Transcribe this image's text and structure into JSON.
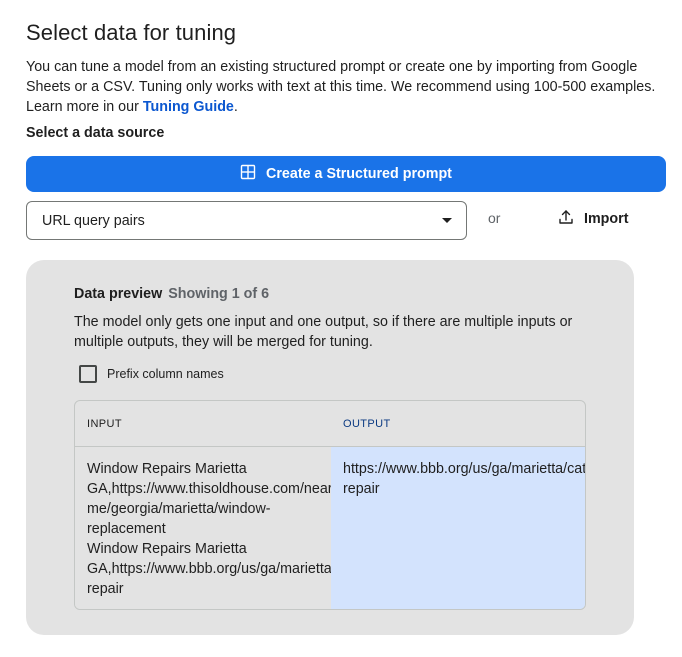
{
  "header": {
    "title": "Select data for tuning",
    "description_pre": "You can tune a model from an existing structured prompt or create one by importing from Google Sheets or a CSV. Tuning only works with text at this time. We recommend using 100-500 examples. Learn more in our ",
    "guide_link": "Tuning Guide",
    "description_post": "."
  },
  "source": {
    "label": "Select a data source",
    "create_button": "Create a Structured prompt",
    "selected": "URL query pairs",
    "or": "or",
    "import_button": "Import"
  },
  "preview": {
    "title": "Data preview",
    "count": "Showing 1 of 6",
    "description": "The model only gets one input and one output, so if there are multiple inputs or multiple outputs, they will be merged for tuning.",
    "prefix_label": "Prefix column names",
    "columns": [
      "INPUT",
      "OUTPUT"
    ],
    "input_lines": [
      "Window Repairs Marietta",
      "GA,https://www.thisoldhouse.com/near-",
      "me/georgia/marietta/window-",
      "replacement",
      "Window Repairs Marietta",
      "GA,https://www.bbb.org/us/ga/marietta/category/window-",
      "repair"
    ],
    "output_lines": [
      "https://www.bbb.org/us/ga/marietta/category/window-",
      "repair"
    ]
  },
  "colors": {
    "primary": "#1a73e8",
    "link": "#0b57d0",
    "panel": "#e3e3e3",
    "output_highlight": "#d3e3fd"
  },
  "icons": {
    "create": "grid-table-icon",
    "import": "upload-icon",
    "select": "caret-down-icon"
  }
}
